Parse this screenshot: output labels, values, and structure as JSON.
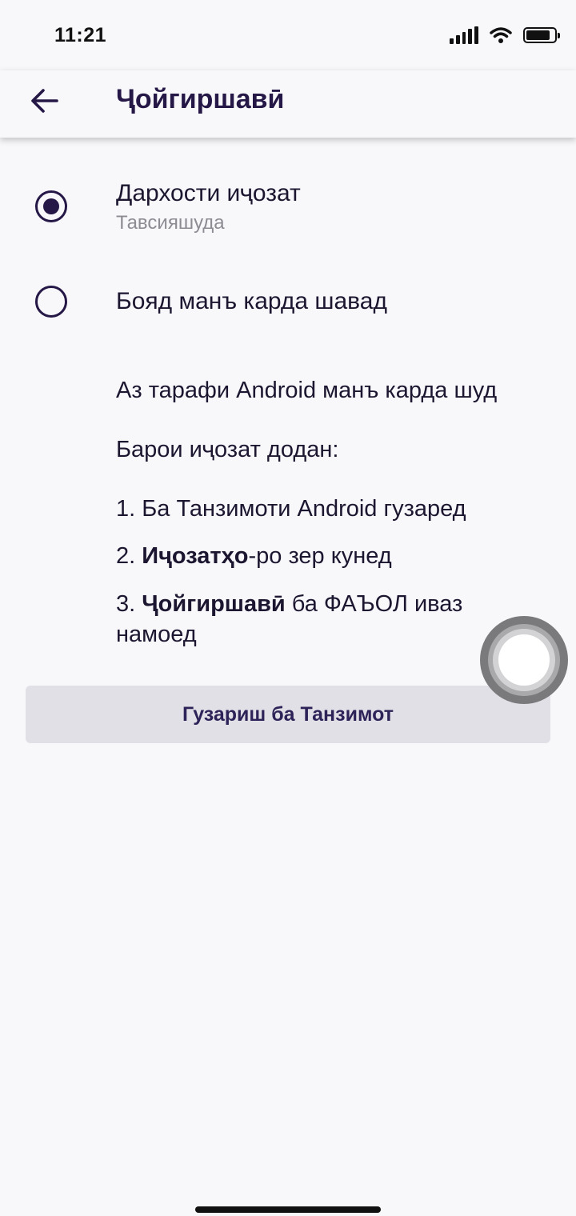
{
  "status_bar": {
    "time": "11:21"
  },
  "header": {
    "title": "Ҷойгиршавӣ"
  },
  "options": [
    {
      "label": "Дархости иҷозат",
      "sublabel": "Тавсияшуда",
      "selected": true
    },
    {
      "label": "Бояд манъ карда шавад",
      "selected": false
    }
  ],
  "info": {
    "denied": "Аз тарафи Android манъ карда шуд",
    "how_to": "Барои иҷозат додан:",
    "step1": "1. Ба Танзимоти Android гузаред",
    "step2_prefix": "2. ",
    "step2_bold": "Иҷозатҳо",
    "step2_suffix": "-ро зер кунед",
    "step3_prefix": "3. ",
    "step3_bold": "Ҷойгиршавӣ",
    "step3_suffix": " ба ФАЪОЛ иваз намоед"
  },
  "settings_button": "Гузариш ба Танзимот",
  "colors": {
    "accent": "#251847",
    "background": "#f8f8fb",
    "button_bg": "#e1e0e6",
    "muted": "#8d8c93"
  }
}
